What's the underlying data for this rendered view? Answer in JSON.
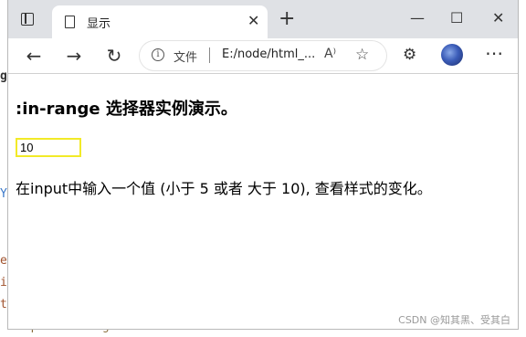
{
  "tab": {
    "title": "显示",
    "close": "✕",
    "new_tab": "+"
  },
  "window_controls": {
    "minimize": "—",
    "maximize": "☐",
    "close": "✕"
  },
  "nav": {
    "back": "←",
    "forward": "→",
    "refresh": "↻"
  },
  "address": {
    "info_icon": "i",
    "scheme_label": "文件",
    "url": "E:/node/html_...",
    "read_aloud": "A⁾"
  },
  "toolbar": {
    "favorite_icon": "☆",
    "extensions_icon": "⚙",
    "more_icon": "⋯"
  },
  "page": {
    "heading": ":in-range 选择器实例演示。",
    "input_value": "10",
    "description": "在input中输入一个值 (小于 5 或者 大于 10), 查看样式的变化。"
  },
  "background": {
    "fragment_1": "e",
    "fragment_2": "i",
    "fragment_3": "t",
    "fragment_4": "Y",
    "fragment_5": "input:in-range"
  },
  "watermark": "CSDN @知其黑、受其白"
}
